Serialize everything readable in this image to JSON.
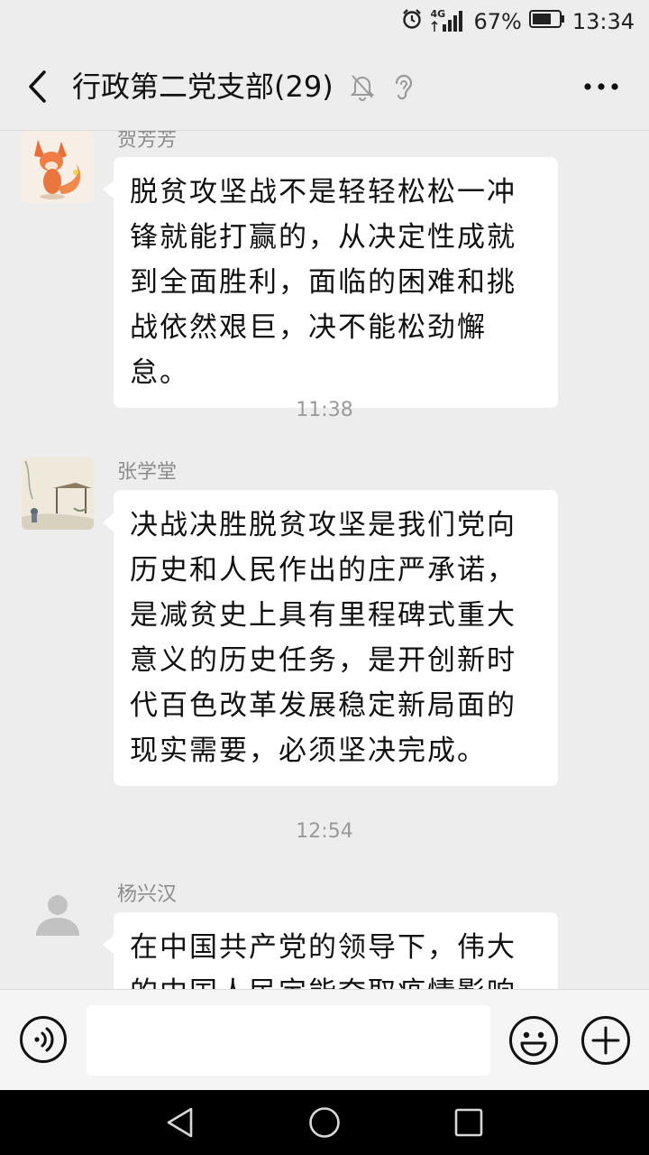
{
  "status_bar": {
    "network": "4G",
    "battery": "67%",
    "time": "13:34"
  },
  "header": {
    "title": "行政第二党支部(29)",
    "back_icon": "chevron-left-icon",
    "mute_icon": "bell-off-icon",
    "earpiece_icon": "ear-icon",
    "more_icon": "more-dots-icon"
  },
  "messages": [
    {
      "sender": "贺芳芳",
      "text": "脱贫攻坚战不是轻轻松松一冲\n锋就能打赢的，从决定性成就\n到全面胜利，面临的困难和挑\n战依然艰巨，决不能松劲懈怠。"
    },
    {
      "timestamp": "11:38",
      "sender": "张学堂",
      "text": "决战决胜脱贫攻坚是我们党向\n历史和人民作出的庄严承诺，\n是减贫史上具有里程碑式重大\n意义的历史任务，是开创新时\n代百色改革发展稳定新局面的\n现实需要，必须坚决完成。"
    },
    {
      "timestamp": "12:54",
      "sender": "杨兴汉",
      "text": "在中国共产党的领导下，伟大\n的中国人民定能夺取疫情影响"
    }
  ],
  "input_bar": {
    "voice_icon": "voice-icon",
    "input_value": "",
    "emoji_icon": "emoji-icon",
    "plus_icon": "plus-icon"
  },
  "colors": {
    "background": "#ededed",
    "bubble": "#ffffff",
    "meta_text": "#9a9a9a"
  }
}
